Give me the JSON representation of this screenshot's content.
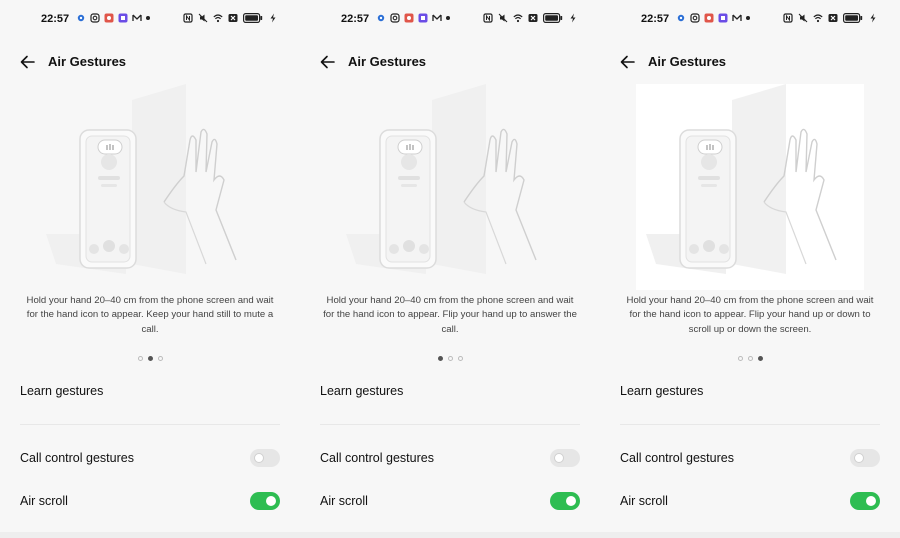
{
  "panels": [
    {
      "time": "22:57",
      "title": "Air Gestures",
      "caption": "Hold your hand 20–40 cm from the phone screen and wait for the hand icon to appear. Keep your hand still to mute a call.",
      "active_page": 1,
      "learn_gestures": "Learn gestures",
      "call_control_label": "Call control gestures",
      "call_control_on": false,
      "air_scroll_label": "Air scroll",
      "air_scroll_on": true
    },
    {
      "time": "22:57",
      "title": "Air Gestures",
      "caption": "Hold your hand 20–40 cm from the phone screen and wait for the hand icon to appear. Flip your hand up to answer the call.",
      "active_page": 0,
      "learn_gestures": "Learn gestures",
      "call_control_label": "Call control gestures",
      "call_control_on": false,
      "air_scroll_label": "Air scroll",
      "air_scroll_on": true
    },
    {
      "time": "22:57",
      "title": "Air Gestures",
      "caption": "Hold your hand 20–40 cm from the phone screen and wait for the hand icon to appear. Flip your hand up or down to scroll up or down the screen.",
      "active_page": 2,
      "learn_gestures": "Learn gestures",
      "call_control_label": "Call control gestures",
      "call_control_on": false,
      "air_scroll_label": "Air scroll",
      "air_scroll_on": true
    }
  ],
  "page_count": 3,
  "icons": {
    "back": "arrow-left-icon",
    "status_left": [
      "gear-icon",
      "instagram-icon",
      "app-icon",
      "app-icon",
      "mail-icon",
      "dot-icon"
    ],
    "status_right": [
      "nfc-icon",
      "mute-icon",
      "wifi-icon",
      "x-icon",
      "battery-icon",
      "charging-icon"
    ]
  },
  "colors": {
    "toggle_on": "#2ebd52",
    "toggle_off": "#e6e6e6",
    "background": "#f7f7f7"
  }
}
